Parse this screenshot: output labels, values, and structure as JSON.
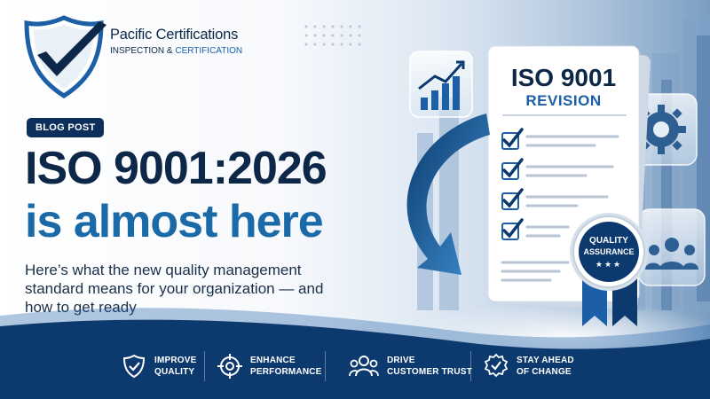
{
  "logo": {
    "name": "Pacific Certifications",
    "tagline_part1": "INSPECTION & ",
    "tagline_part2": "CERTIFICATION"
  },
  "badge": "BLOG POST",
  "headline": {
    "line1": "ISO 9001:2026",
    "line2": "is almost here"
  },
  "subtitle": "Here’s what the new quality management standard means for your organization — and how to get ready",
  "document": {
    "title": "ISO 9001",
    "subtitle": "REVISION"
  },
  "seal": {
    "line1": "QUALITY",
    "line2": "ASSURANCE",
    "stars": "★★★"
  },
  "features": [
    {
      "label": "IMPROVE\nQUALITY",
      "icon": "shield-check-icon"
    },
    {
      "label": "ENHANCE\nPERFORMANCE",
      "icon": "target-icon"
    },
    {
      "label": "DRIVE\nCUSTOMER TRUST",
      "icon": "people-icon"
    },
    {
      "label": "STAY AHEAD\nOF CHANGE",
      "icon": "badge-check-icon"
    }
  ],
  "colors": {
    "navy": "#0d2748",
    "accent_blue": "#1a6aa8",
    "footer_blue": "#0d3a6e"
  }
}
